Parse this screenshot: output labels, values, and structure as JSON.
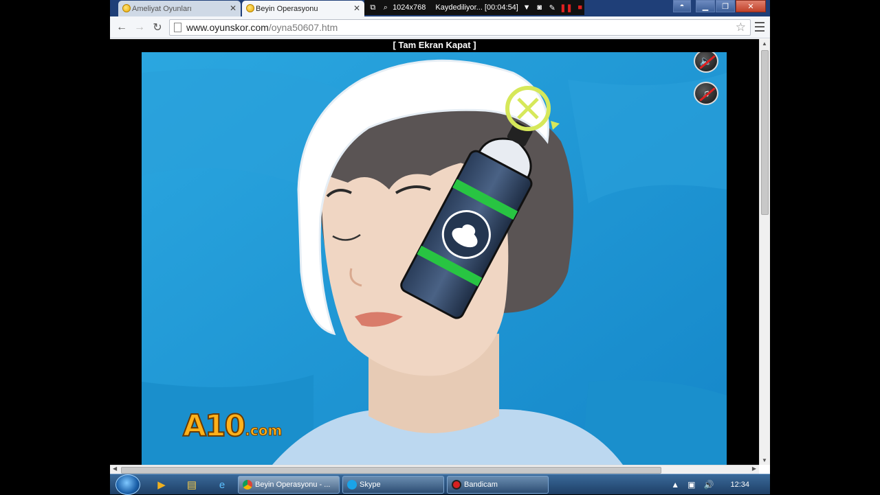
{
  "window": {
    "tabs": [
      {
        "title": "Ameliyat Oyunları",
        "active": false
      },
      {
        "title": "Beyin Operasyonu",
        "active": true
      }
    ]
  },
  "recorder": {
    "resolution": "1024x768",
    "status": "Kaydediliyor... [00:04:54]"
  },
  "toolbar": {
    "url_host": "www.oyunskor.com",
    "url_path": "/oyna50607.htm",
    "icons": [
      "back-arrow-icon",
      "forward-arrow-icon",
      "reload-icon",
      "bookmark-star-icon",
      "menu-icon"
    ]
  },
  "page": {
    "fullscreen_link": "[ Tam Ekran Kapat ]",
    "logo_main": "A10",
    "logo_suffix": ".com"
  },
  "taskbar": {
    "tasks": [
      {
        "label": "Beyin Operasyonu - ...",
        "active": true
      },
      {
        "label": "Skype",
        "active": false
      },
      {
        "label": "Bandicam",
        "active": false
      }
    ],
    "clock": "12:34"
  },
  "colors": {
    "game_background": "#1f9ad6",
    "titlebar": "#1f3f78",
    "logo": "#ffb11a"
  }
}
